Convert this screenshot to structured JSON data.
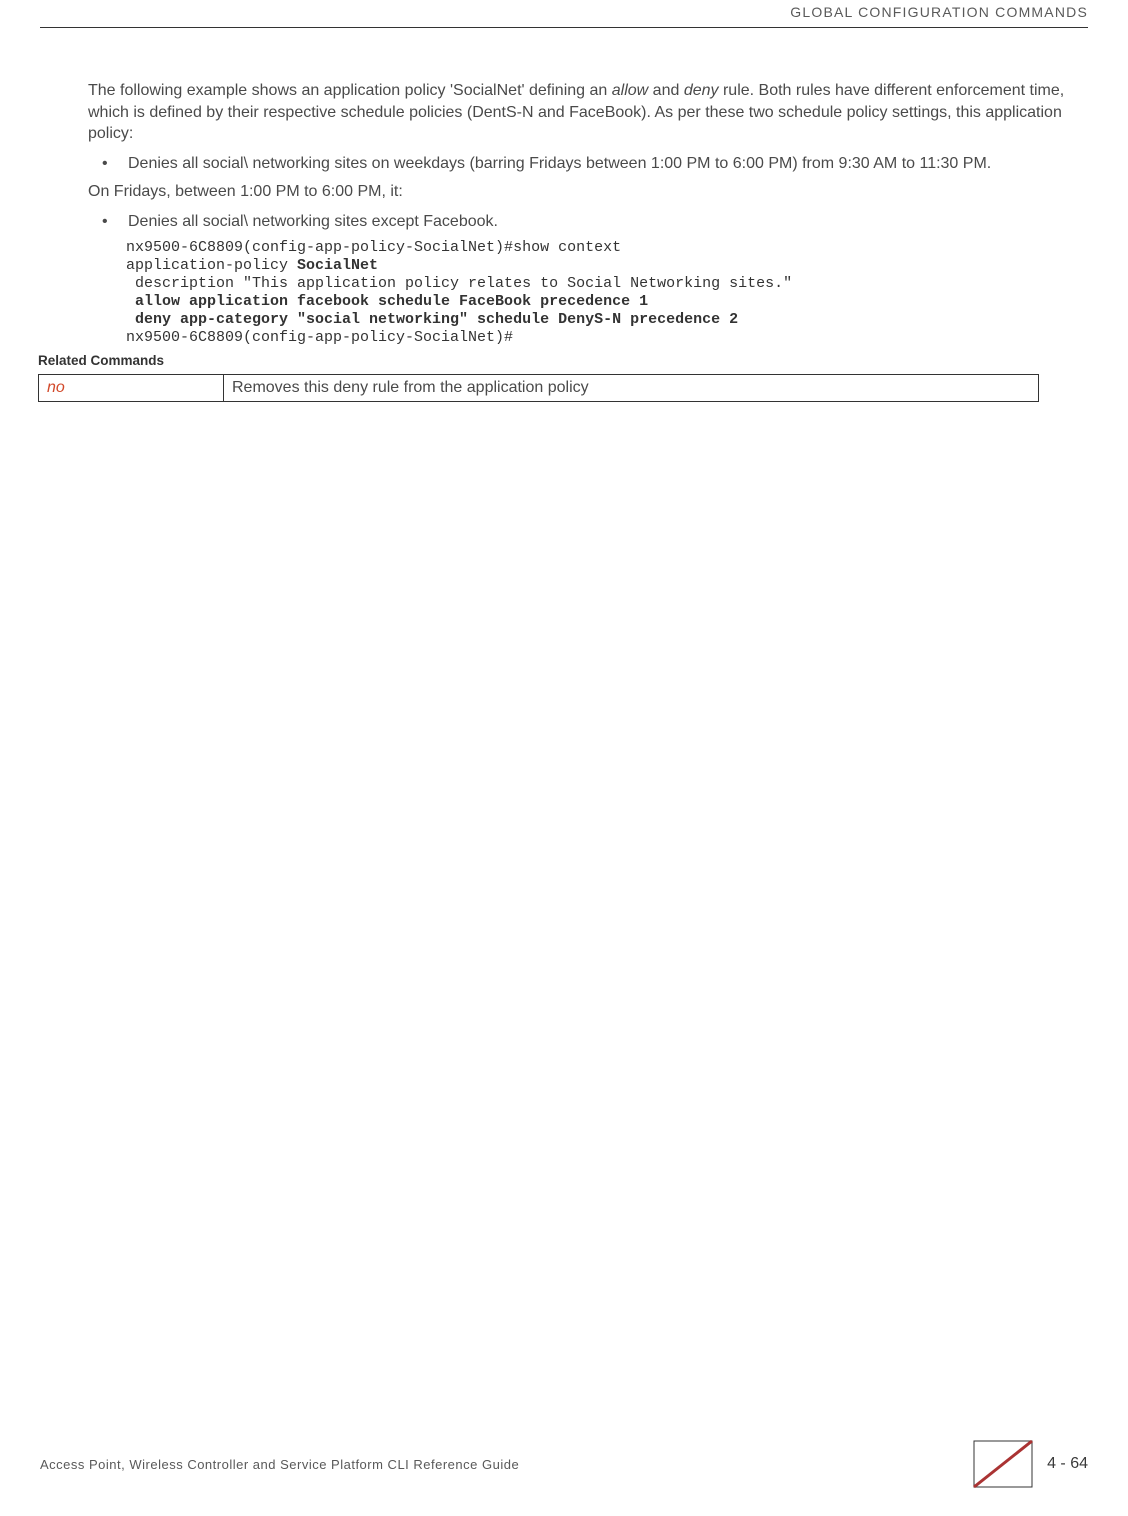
{
  "header": {
    "category": "GLOBAL CONFIGURATION COMMANDS"
  },
  "intro": {
    "p1_a": "The following example shows an application policy 'SocialNet' defining an ",
    "p1_b": "allow",
    "p1_c": " and ",
    "p1_d": "deny",
    "p1_e": " rule. Both rules have different enforcement time, which is defined by their respective schedule policies (DentS-N and FaceBook). As per these two schedule policy settings, this application policy:"
  },
  "bullets1": [
    "Denies all social\\ networking sites on weekdays (barring Fridays between 1:00 PM to 6:00 PM) from 9:30 AM to 11:30 PM."
  ],
  "mid": "On Fridays, between 1:00 PM to 6:00 PM, it:",
  "bullets2": [
    "Denies all social\\ networking sites except Facebook."
  ],
  "code": {
    "l1": "nx9500-6C8809(config-app-policy-SocialNet)#show context",
    "l2a": "application-policy ",
    "l2b": "SocialNet",
    "l3": " description \"This application policy relates to Social Networking sites.\"",
    "l4": " allow application facebook schedule FaceBook precedence 1",
    "l5": " deny app-category \"social networking\" schedule DenyS-N precedence 2",
    "l6": "nx9500-6C8809(config-app-policy-SocialNet)#"
  },
  "related": {
    "heading": "Related Commands",
    "cmd": "no",
    "desc": "Removes this deny rule from the application policy"
  },
  "footer": {
    "left": "Access Point, Wireless Controller and Service Platform CLI Reference Guide",
    "pagenum": "4 - 64"
  }
}
